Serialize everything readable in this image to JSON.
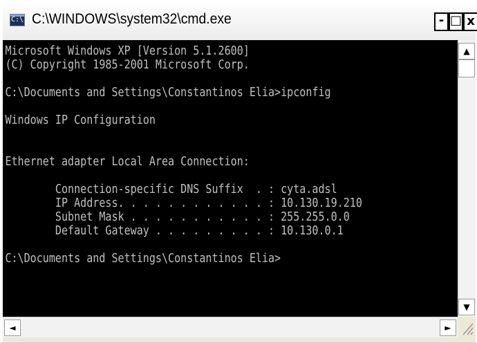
{
  "window": {
    "title": "C:\\WINDOWS\\system32\\cmd.exe",
    "icon": "cmd-icon",
    "icon_text": "C:\\",
    "buttons": {
      "minimize": "-",
      "maximize": "□",
      "close": "x"
    }
  },
  "console": {
    "lines": [
      "Microsoft Windows XP [Version 5.1.2600]",
      "(C) Copyright 1985-2001 Microsoft Corp.",
      "",
      "C:\\Documents and Settings\\Constantinos Elia>ipconfig",
      "",
      "Windows IP Configuration",
      "",
      "",
      "Ethernet adapter Local Area Connection:",
      "",
      "        Connection-specific DNS Suffix  . : cyta.adsl",
      "        IP Address. . . . . . . . . . . . : 10.130.19.210",
      "        Subnet Mask . . . . . . . . . . . : 255.255.0.0",
      "        Default Gateway . . . . . . . . . : 10.130.0.1",
      "",
      "C:\\Documents and Settings\\Constantinos Elia>"
    ]
  },
  "scrollbars": {
    "up": "▲",
    "down": "▼",
    "left": "◄",
    "right": "►"
  },
  "colors": {
    "console_bg": "#000000",
    "console_fg": "#c0c0c0"
  }
}
